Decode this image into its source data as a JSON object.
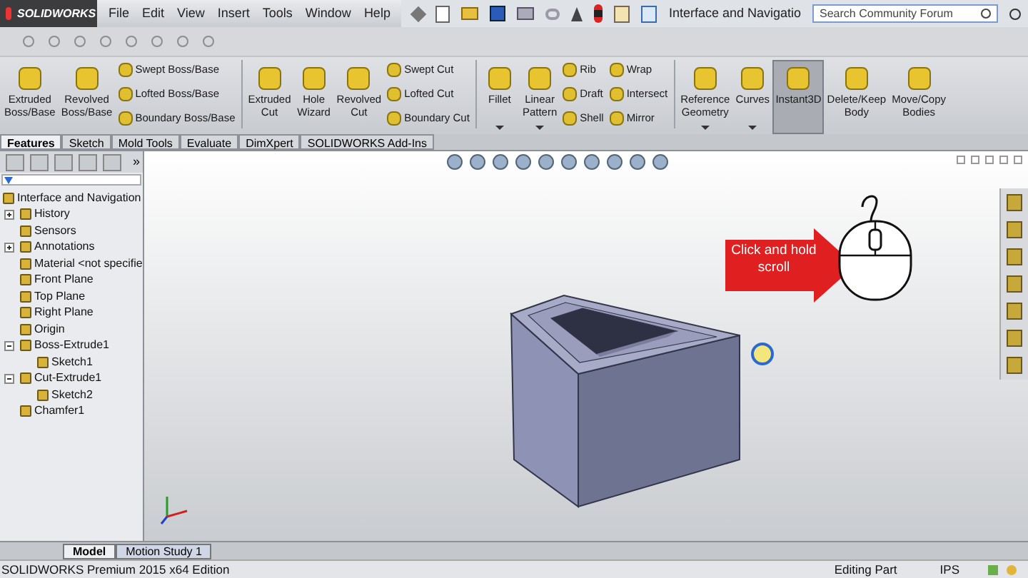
{
  "app": {
    "logo": "SOLIDWORKS"
  },
  "menu": [
    "File",
    "Edit",
    "View",
    "Insert",
    "Tools",
    "Window",
    "Help"
  ],
  "document_title": "Interface and Navigatio",
  "search": {
    "placeholder": "Search Community Forum"
  },
  "ribbon": [
    {
      "kind": "large",
      "label": "Extruded Boss/Base",
      "dropdown": false,
      "pressed": false
    },
    {
      "kind": "large",
      "label": "Revolved Boss/Base",
      "dropdown": false,
      "pressed": false
    },
    {
      "kind": "stack",
      "items": [
        "Swept Boss/Base",
        "Lofted Boss/Base",
        "Boundary Boss/Base"
      ]
    },
    {
      "kind": "divider"
    },
    {
      "kind": "large",
      "label": "Extruded Cut",
      "dropdown": false,
      "pressed": false
    },
    {
      "kind": "large",
      "label": "Hole Wizard",
      "dropdown": false,
      "pressed": false
    },
    {
      "kind": "large",
      "label": "Revolved Cut",
      "dropdown": false,
      "pressed": false
    },
    {
      "kind": "stack",
      "items": [
        "Swept Cut",
        "Lofted Cut",
        "Boundary Cut"
      ]
    },
    {
      "kind": "divider"
    },
    {
      "kind": "large",
      "label": "Fillet",
      "dropdown": true,
      "pressed": false
    },
    {
      "kind": "large",
      "label": "Linear Pattern",
      "dropdown": true,
      "pressed": false
    },
    {
      "kind": "stack",
      "items": [
        "Rib",
        "Draft",
        "Shell"
      ]
    },
    {
      "kind": "stack",
      "items": [
        "Wrap",
        "Intersect",
        "Mirror"
      ]
    },
    {
      "kind": "divider"
    },
    {
      "kind": "large",
      "label": "Reference Geometry",
      "dropdown": true,
      "pressed": false
    },
    {
      "kind": "large",
      "label": "Curves",
      "dropdown": true,
      "pressed": false
    },
    {
      "kind": "large",
      "label": "Instant3D",
      "dropdown": false,
      "pressed": true
    },
    {
      "kind": "large",
      "label": "Delete/Keep Body",
      "dropdown": false,
      "pressed": false
    },
    {
      "kind": "large",
      "label": "Move/Copy Bodies",
      "dropdown": false,
      "pressed": false
    }
  ],
  "tabs": [
    {
      "label": "Features",
      "selected": true
    },
    {
      "label": "Sketch",
      "selected": false
    },
    {
      "label": "Mold Tools",
      "selected": false
    },
    {
      "label": "Evaluate",
      "selected": false
    },
    {
      "label": "DimXpert",
      "selected": false
    },
    {
      "label": "SOLIDWORKS Add-Ins",
      "selected": false
    }
  ],
  "panel_more": "»",
  "tree": {
    "label": "Interface and Navigation",
    "children": [
      {
        "label": "History",
        "expanded": false
      },
      {
        "label": "Sensors"
      },
      {
        "label": "Annotations",
        "expanded": false
      },
      {
        "label": "Material <not specifie"
      },
      {
        "label": "Front Plane"
      },
      {
        "label": "Top Plane"
      },
      {
        "label": "Right Plane"
      },
      {
        "label": "Origin"
      },
      {
        "label": "Boss-Extrude1",
        "expanded": true,
        "children": [
          {
            "label": "Sketch1"
          }
        ]
      },
      {
        "label": "Cut-Extrude1",
        "expanded": true,
        "children": [
          {
            "label": "Sketch2"
          }
        ]
      },
      {
        "label": "Chamfer1"
      }
    ]
  },
  "callout": "Click and hold scroll",
  "bottom_tabs": [
    {
      "label": "Model",
      "selected": true
    },
    {
      "label": "Motion Study 1",
      "selected": false
    }
  ],
  "status_bar": {
    "edition": "SOLIDWORKS Premium 2015 x64 Edition",
    "mode": "Editing Part",
    "units": "IPS"
  }
}
